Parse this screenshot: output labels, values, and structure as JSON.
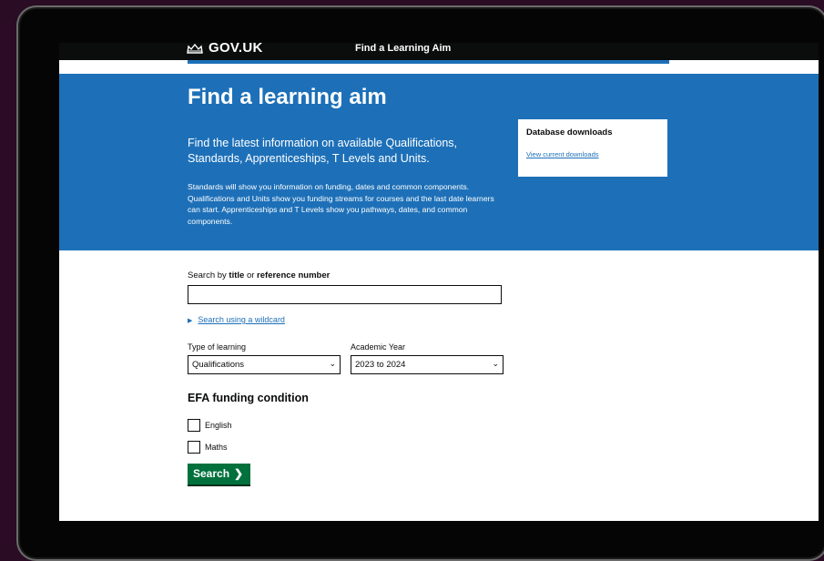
{
  "header": {
    "logo_text": "GOV.UK",
    "service_name": "Find a Learning Aim"
  },
  "hero": {
    "title": "Find a learning aim",
    "lead": "Find the latest information on available Qualifications, Standards, Apprenticeships, T Levels and Units.",
    "body": "Standards will show you information on funding, dates and common components. Qualifications and Units show you funding streams for courses and the last date learners can start. Apprenticeships and T Levels show you pathways, dates, and common components."
  },
  "downloads": {
    "title": "Database downloads",
    "link": "View current downloads"
  },
  "search": {
    "label_prefix": "Search by ",
    "label_title": "title",
    "label_or": " or ",
    "label_ref": "reference number",
    "value": "",
    "wildcard_link": "Search using a wildcard"
  },
  "filters": {
    "type_label": "Type of learning",
    "type_value": "Qualifications",
    "year_label": "Academic Year",
    "year_value": "2023 to 2024"
  },
  "efa": {
    "heading": "EFA funding condition",
    "options": [
      {
        "label": "English",
        "checked": false
      },
      {
        "label": "Maths",
        "checked": false
      }
    ]
  },
  "actions": {
    "search_label": "Search",
    "search_icon": "chevron-right-icon"
  },
  "colors": {
    "brand_blue": "#1d70b8",
    "button_green": "#00703c",
    "header_black": "#0b0c0c"
  }
}
